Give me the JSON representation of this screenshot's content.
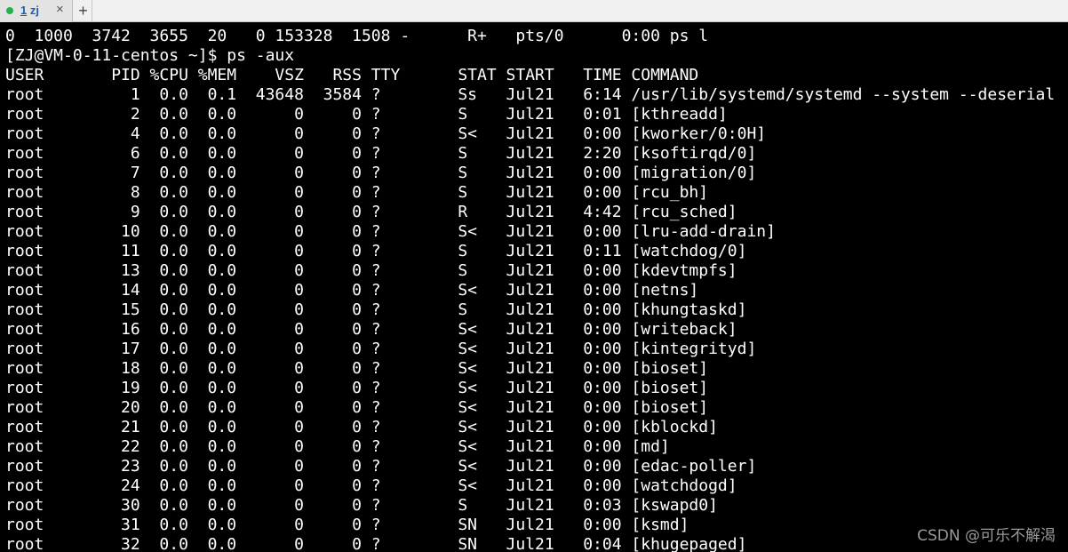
{
  "tab": {
    "number": "1",
    "name": "zj",
    "close_symbol": "×",
    "status_color": "#22b14c"
  },
  "add_tab_symbol": "+",
  "terminal": {
    "lines": [
      "0  1000  3742  3655  20   0 153328  1508 -      R+   pts/0      0:00 ps l",
      "[ZJ@VM-0-11-centos ~]$ ps -aux",
      "USER       PID %CPU %MEM    VSZ   RSS TTY      STAT START   TIME COMMAND",
      "root         1  0.0  0.1  43648  3584 ?        Ss   Jul21   6:14 /usr/lib/systemd/systemd --system --deserial",
      "root         2  0.0  0.0      0     0 ?        S    Jul21   0:01 [kthreadd]",
      "root         4  0.0  0.0      0     0 ?        S<   Jul21   0:00 [kworker/0:0H]",
      "root         6  0.0  0.0      0     0 ?        S    Jul21   2:20 [ksoftirqd/0]",
      "root         7  0.0  0.0      0     0 ?        S    Jul21   0:00 [migration/0]",
      "root         8  0.0  0.0      0     0 ?        S    Jul21   0:00 [rcu_bh]",
      "root         9  0.0  0.0      0     0 ?        R    Jul21   4:42 [rcu_sched]",
      "root        10  0.0  0.0      0     0 ?        S<   Jul21   0:00 [lru-add-drain]",
      "root        11  0.0  0.0      0     0 ?        S    Jul21   0:11 [watchdog/0]",
      "root        13  0.0  0.0      0     0 ?        S    Jul21   0:00 [kdevtmpfs]",
      "root        14  0.0  0.0      0     0 ?        S<   Jul21   0:00 [netns]",
      "root        15  0.0  0.0      0     0 ?        S    Jul21   0:00 [khungtaskd]",
      "root        16  0.0  0.0      0     0 ?        S<   Jul21   0:00 [writeback]",
      "root        17  0.0  0.0      0     0 ?        S<   Jul21   0:00 [kintegrityd]",
      "root        18  0.0  0.0      0     0 ?        S<   Jul21   0:00 [bioset]",
      "root        19  0.0  0.0      0     0 ?        S<   Jul21   0:00 [bioset]",
      "root        20  0.0  0.0      0     0 ?        S<   Jul21   0:00 [bioset]",
      "root        21  0.0  0.0      0     0 ?        S<   Jul21   0:00 [kblockd]",
      "root        22  0.0  0.0      0     0 ?        S<   Jul21   0:00 [md]",
      "root        23  0.0  0.0      0     0 ?        S<   Jul21   0:00 [edac-poller]",
      "root        24  0.0  0.0      0     0 ?        S<   Jul21   0:00 [watchdogd]",
      "root        30  0.0  0.0      0     0 ?        S    Jul21   0:03 [kswapd0]",
      "root        31  0.0  0.0      0     0 ?        SN   Jul21   0:00 [ksmd]",
      "root        32  0.0  0.0      0     0 ?        SN   Jul21   0:04 [khugepaged]"
    ]
  },
  "watermark": "CSDN @可乐不解渴"
}
